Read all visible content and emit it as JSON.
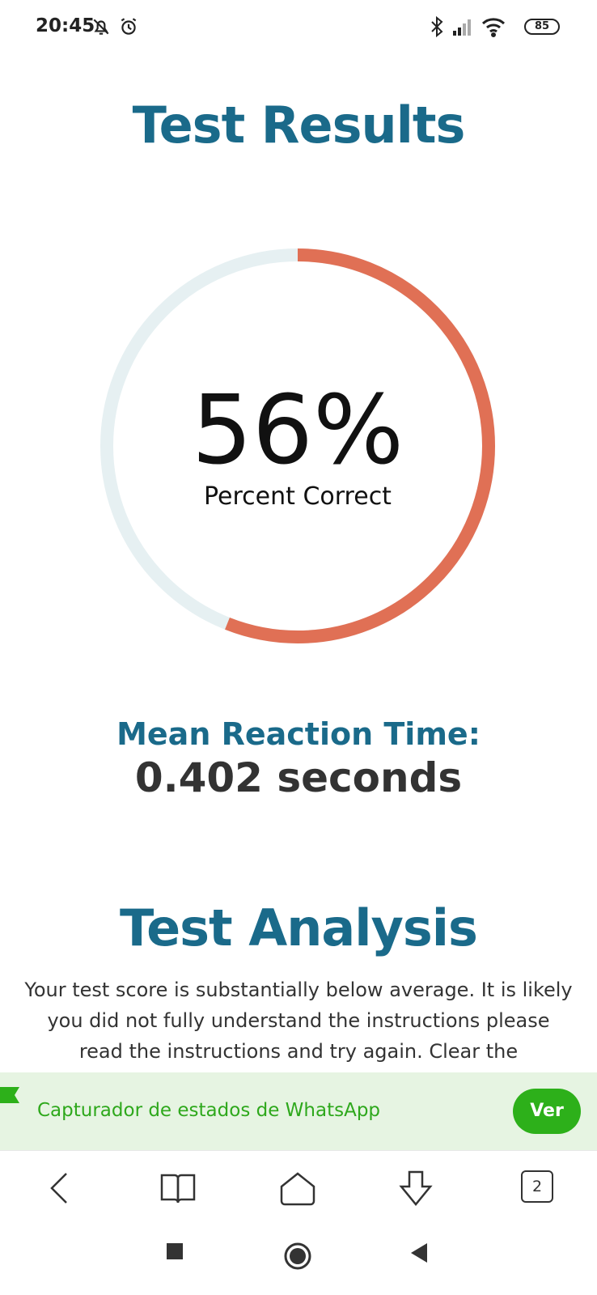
{
  "status_bar": {
    "time": "20:45",
    "battery": "85",
    "icons": [
      "bell-off-icon",
      "alarm-icon",
      "bluetooth-icon",
      "signal-icon",
      "wifi-icon",
      "battery-icon"
    ]
  },
  "results": {
    "title": "Test Results",
    "percent_text": "56%",
    "percent_value": 56,
    "percent_label": "Percent Correct",
    "mean_reaction_label": "Mean Reaction Time:",
    "mean_reaction_value": "0.402 seconds"
  },
  "analysis": {
    "title": "Test Analysis",
    "text": "Your test score is substantially below average. It is likely you did not fully understand the instructions please read the instructions and try again. Clear the environment of any"
  },
  "ad_banner": {
    "text": "Capturador de estados de WhatsApp",
    "button_label": "Ver"
  },
  "browser_toolbar": {
    "tab_count": "2"
  },
  "colors": {
    "accent_blue": "#1a6a8a",
    "gauge_fill": "#e07055",
    "gauge_track": "#e6f0f2",
    "ad_green": "#2db01a"
  }
}
